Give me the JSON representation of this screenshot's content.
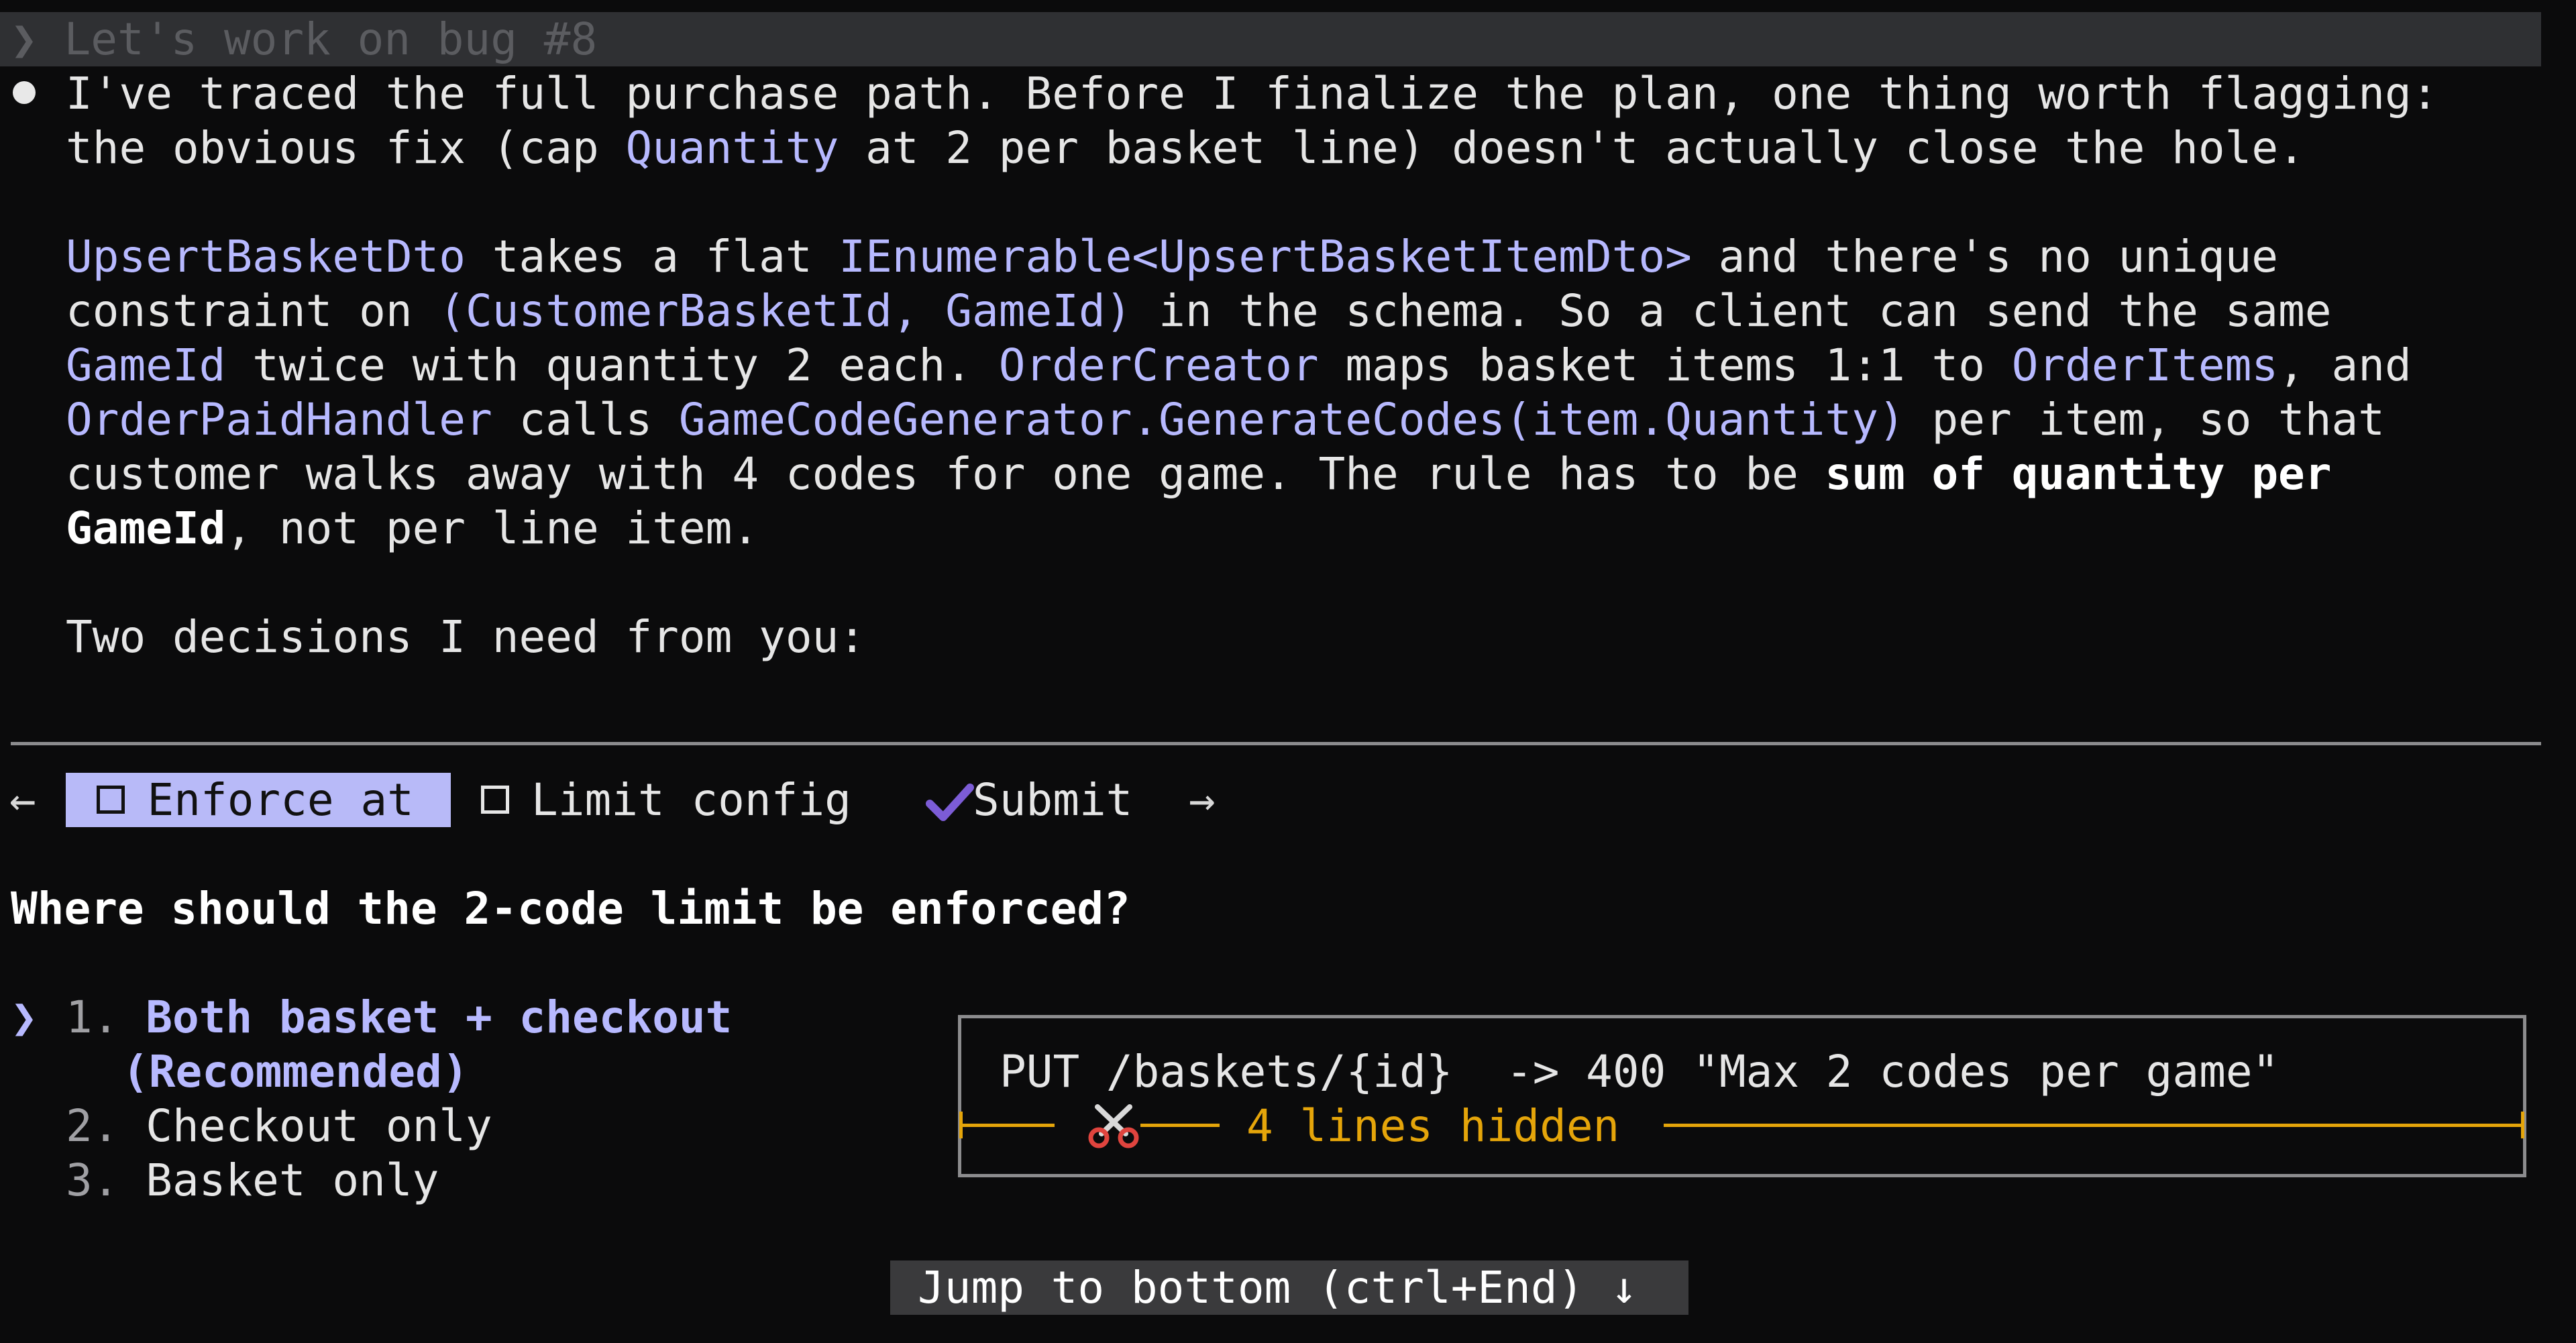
{
  "prompt": {
    "glyph": "❯",
    "text": "Let's work on bug #8"
  },
  "message": {
    "line1": "I've traced the full purchase path. Before I finalize the plan, one thing worth flagging:",
    "line2_a": "the obvious fix (cap ",
    "line2_code": "Quantity",
    "line2_b": " at 2 per basket line) doesn't actually close the hole.",
    "p2_l1_code1": "UpsertBasketDto",
    "p2_l1_a": " takes a flat ",
    "p2_l1_code2": "IEnumerable<UpsertBasketItemDto>",
    "p2_l1_b": " and there's no unique",
    "p2_l2_a": "constraint on ",
    "p2_l2_code": "(CustomerBasketId, GameId)",
    "p2_l2_b": " in the schema. So a client can send the same",
    "p2_l3_code1": "GameId",
    "p2_l3_a": " twice with quantity 2 each. ",
    "p2_l3_code2": "OrderCreator",
    "p2_l3_b": " maps basket items 1:1 to ",
    "p2_l3_code3": "OrderItems",
    "p2_l3_c": ", and",
    "p2_l4_code1": "OrderPaidHandler",
    "p2_l4_a": " calls ",
    "p2_l4_code2": "GameCodeGenerator.GenerateCodes(item.Quantity)",
    "p2_l4_b": " per item, so that",
    "p2_l5_a": "customer walks away with 4 codes for one game. The rule has to be ",
    "p2_l5_bold": "sum of quantity per",
    "p2_l6_bold": "GameId",
    "p2_l6_a": ", not per line item.",
    "p3": "Two decisions I need from you:"
  },
  "tabs": {
    "back_arrow": "←",
    "enforce_label": "Enforce at",
    "limit_label": "Limit config",
    "submit_label": "Submit",
    "forward_arrow": "→",
    "accent": "#b8baf8",
    "submit_check_color": "#7c5cd6"
  },
  "question": "Where should the 2-code limit be enforced?",
  "options": {
    "cursor": "❯",
    "opt1_num": "1. ",
    "opt1_line1": "Both basket + checkout",
    "opt1_line2": "(Recommended)",
    "opt2_num": "2. ",
    "opt2_label": "Checkout only",
    "opt3_num": "3. ",
    "opt3_label": "Basket only"
  },
  "preview": {
    "text": "PUT /baskets/{id}  -> 400 \"Max 2 codes per game\"",
    "hidden_label": "4 lines hidden",
    "hidden_color": "#e5a50a",
    "icon": "scissors-icon"
  },
  "jump": {
    "label": "Jump to bottom (ctrl+End) ↓"
  }
}
